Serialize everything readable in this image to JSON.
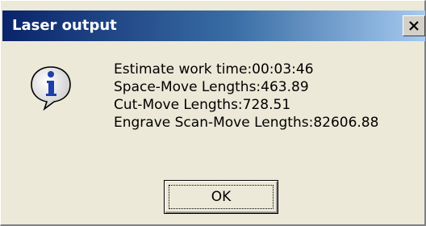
{
  "dialog": {
    "title": "Laser output",
    "close_icon": "close-icon",
    "icon": "info-icon",
    "messages": [
      "Estimate work time:00:03:46",
      "Space-Move Lengths:463.89",
      "Cut-Move Lengths:728.51",
      "Engrave Scan-Move Lengths:82606.88"
    ],
    "ok_label": "OK"
  },
  "colors": {
    "title_gradient_start": "#0a246a",
    "title_gradient_end": "#a6caf0",
    "dialog_background": "#ece9d8",
    "icon_blue": "#1f3fa8"
  }
}
